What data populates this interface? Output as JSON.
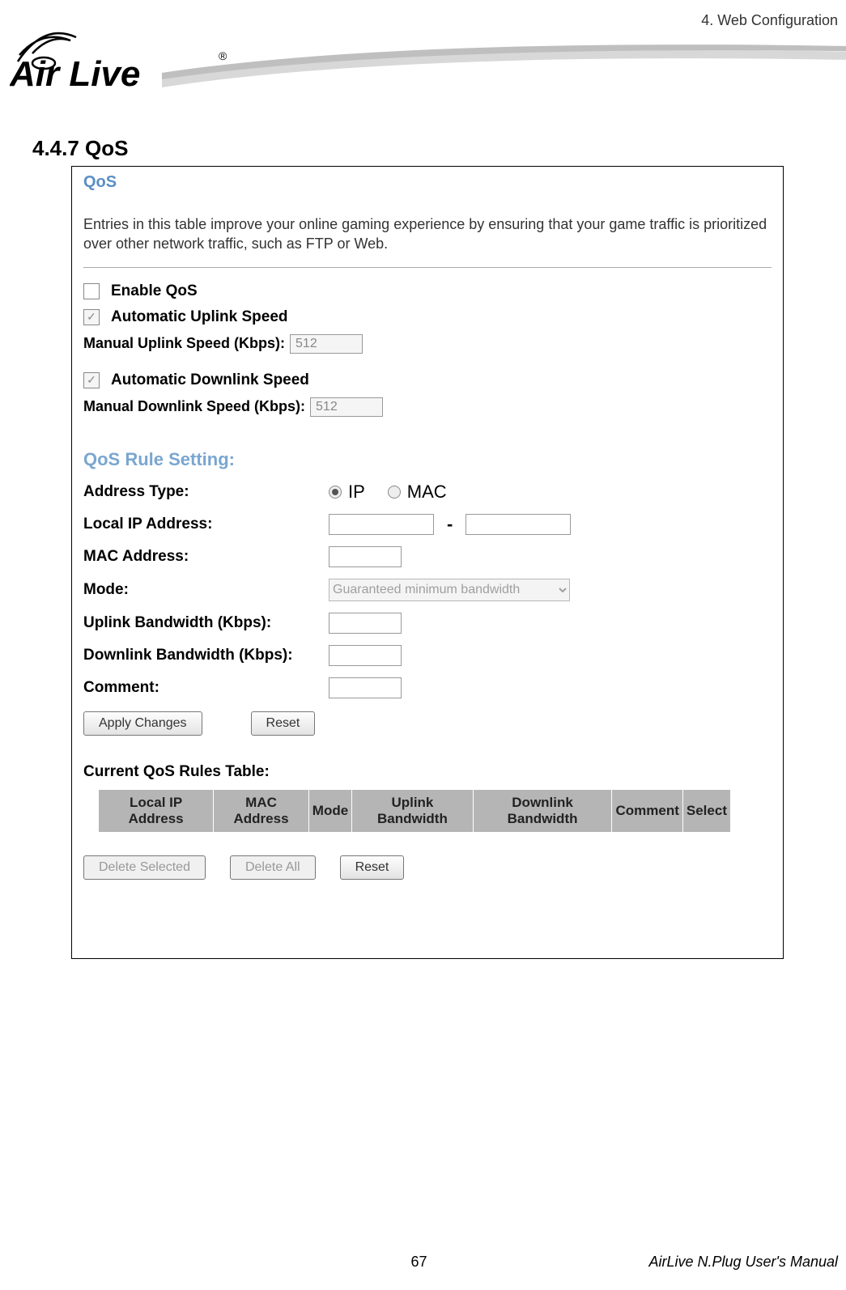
{
  "header": {
    "breadcrumb": "4. Web Configuration"
  },
  "logo": {
    "name": "Air Live",
    "reg": "®"
  },
  "section": {
    "heading": "4.4.7 QoS"
  },
  "panel": {
    "title": "QoS",
    "intro": "Entries in this table improve your online gaming experience by ensuring that your game traffic is prioritized over other network traffic, such as FTP or Web.",
    "enable_qos": "Enable QoS",
    "auto_uplink": "Automatic Uplink Speed",
    "manual_uplink_label": "Manual Uplink Speed (Kbps):",
    "manual_uplink_value": "512",
    "auto_downlink": "Automatic Downlink Speed",
    "manual_downlink_label": "Manual Downlink Speed (Kbps):",
    "manual_downlink_value": "512"
  },
  "rule": {
    "heading": "QoS Rule Setting:",
    "address_type": "Address Type:",
    "ip": "IP",
    "mac": "MAC",
    "local_ip": "Local IP Address:",
    "mac_addr": "MAC Address:",
    "mode": "Mode:",
    "mode_option": "Guaranteed minimum bandwidth",
    "uplink_bw": "Uplink Bandwidth (Kbps):",
    "downlink_bw": "Downlink Bandwidth (Kbps):",
    "comment": "Comment:",
    "apply": "Apply Changes",
    "reset": "Reset"
  },
  "table": {
    "title": "Current QoS Rules Table:",
    "headers": [
      "Local IP Address",
      "MAC Address",
      "Mode",
      "Uplink Bandwidth",
      "Downlink Bandwidth",
      "Comment",
      "Select"
    ],
    "delete_selected": "Delete Selected",
    "delete_all": "Delete All",
    "reset2": "Reset"
  },
  "footer": {
    "page": "67",
    "manual": "AirLive N.Plug User's Manual"
  }
}
